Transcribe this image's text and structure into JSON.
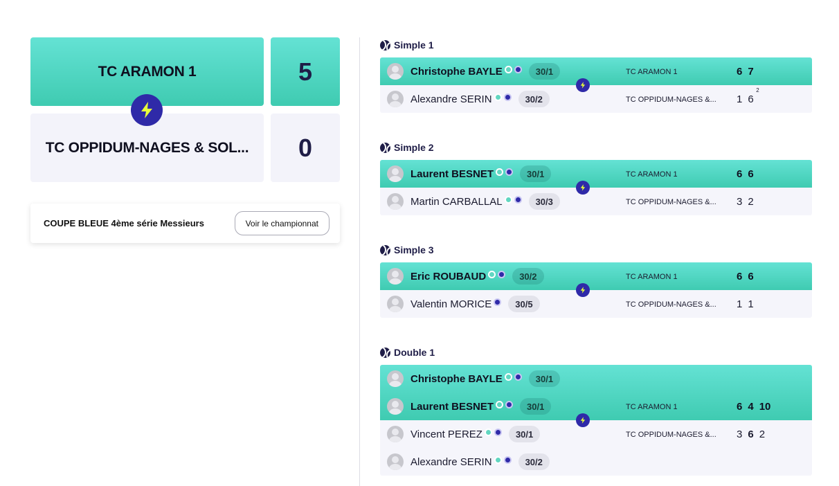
{
  "encounter": {
    "home": {
      "name": "TC ARAMON 1",
      "score": "5"
    },
    "away": {
      "name": "TC OPPIDUM-NAGES & SOL...",
      "score": "0"
    }
  },
  "competition": {
    "name": "COUPE BLEUE 4ème série Messieurs",
    "button": "Voir le championnat"
  },
  "colors": {
    "winner": "#3fcbb1",
    "loser": "#f3f3fa",
    "accent": "#2f2aa8",
    "bolt": "#e8ff3a"
  },
  "matches": [
    {
      "title": "Simple 1",
      "winner": {
        "players": [
          {
            "name": "Christophe BAYLE",
            "rank": "30/1"
          }
        ],
        "club": "TC ARAMON 1",
        "scores": [
          "6",
          "7"
        ]
      },
      "loser": {
        "players": [
          {
            "name": "Alexandre SERIN",
            "rank": "30/2"
          }
        ],
        "club": "TC OPPIDUM-NAGES &...",
        "scores": [
          "1",
          "6"
        ],
        "tiebreak": "2"
      }
    },
    {
      "title": "Simple 2",
      "winner": {
        "players": [
          {
            "name": "Laurent BESNET",
            "rank": "30/1"
          }
        ],
        "club": "TC ARAMON 1",
        "scores": [
          "6",
          "6"
        ]
      },
      "loser": {
        "players": [
          {
            "name": "Martin CARBALLAL",
            "rank": "30/3"
          }
        ],
        "club": "TC OPPIDUM-NAGES &...",
        "scores": [
          "3",
          "2"
        ]
      }
    },
    {
      "title": "Simple 3",
      "winner": {
        "players": [
          {
            "name": "Eric ROUBAUD",
            "rank": "30/2"
          }
        ],
        "club": "TC ARAMON 1",
        "scores": [
          "6",
          "6"
        ]
      },
      "loser": {
        "players": [
          {
            "name": "Valentin MORICE",
            "rank": "30/5"
          }
        ],
        "club": "TC OPPIDUM-NAGES &...",
        "scores": [
          "1",
          "1"
        ]
      }
    },
    {
      "title": "Double 1",
      "winner": {
        "players": [
          {
            "name": "Christophe BAYLE",
            "rank": "30/1"
          },
          {
            "name": "Laurent BESNET",
            "rank": "30/1"
          }
        ],
        "club": "TC ARAMON 1",
        "scores": [
          "6",
          "4",
          "10"
        ]
      },
      "loser": {
        "players": [
          {
            "name": "Vincent PEREZ",
            "rank": "30/1"
          },
          {
            "name": "Alexandre SERIN",
            "rank": "30/2"
          }
        ],
        "club": "TC OPPIDUM-NAGES &...",
        "scores": [
          "3",
          "6",
          "2"
        ]
      }
    }
  ]
}
